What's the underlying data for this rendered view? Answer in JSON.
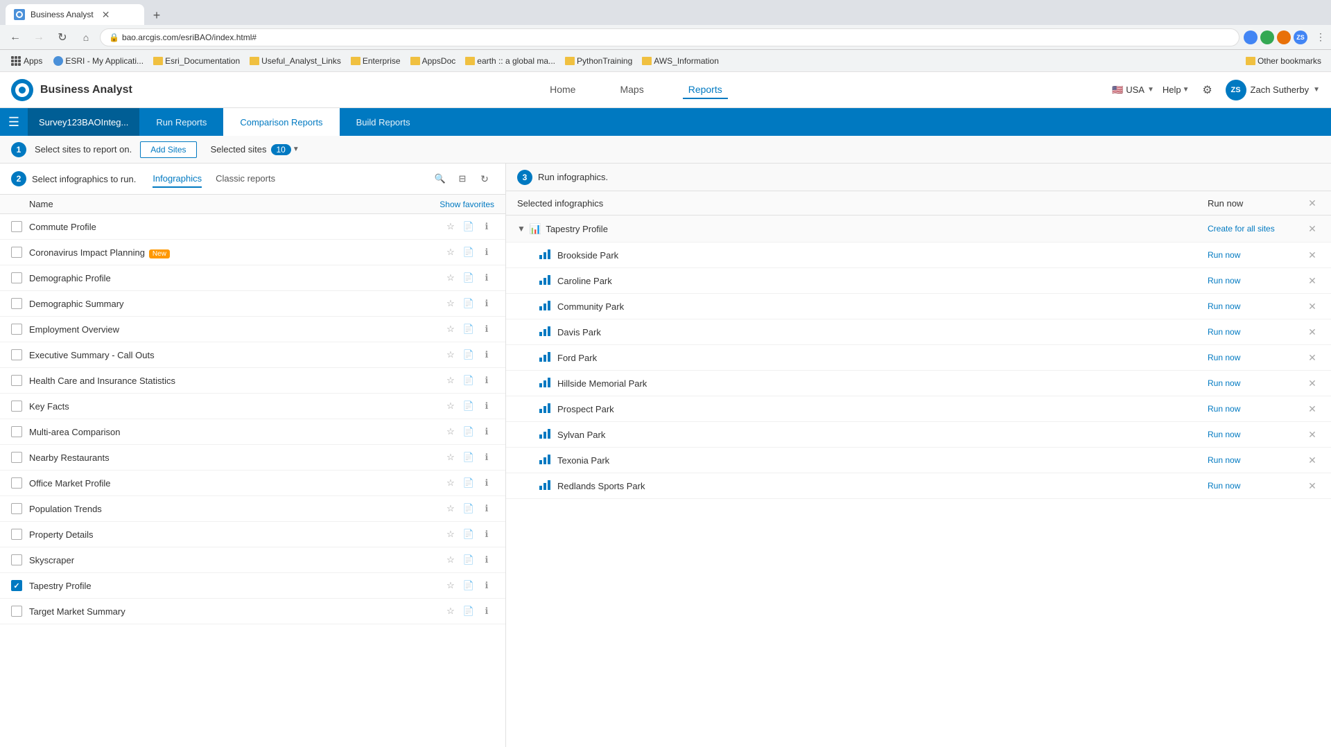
{
  "browser": {
    "tab_title": "Business Analyst",
    "url": "bao.arcgis.com/esriBAO/index.html#",
    "new_tab_label": "+"
  },
  "bookmarks": {
    "apps_label": "Apps",
    "items": [
      {
        "label": "ESRI - My Applicati...",
        "type": "site"
      },
      {
        "label": "Esri_Documentation",
        "type": "folder"
      },
      {
        "label": "Useful_Analyst_Links",
        "type": "folder"
      },
      {
        "label": "Enterprise",
        "type": "folder"
      },
      {
        "label": "AppsDoc",
        "type": "folder"
      },
      {
        "label": "earth :: a global ma...",
        "type": "folder"
      },
      {
        "label": "PythonTraining",
        "type": "folder"
      },
      {
        "label": "AWS_Information",
        "type": "folder"
      },
      {
        "label": "Other bookmarks",
        "type": "folder"
      }
    ]
  },
  "header": {
    "app_title": "Business Analyst",
    "nav_items": [
      "Home",
      "Maps",
      "Reports"
    ],
    "active_nav": "Reports",
    "region": "USA",
    "help_label": "Help",
    "user_name": "Zach Sutherby",
    "user_initials": "ZS"
  },
  "sub_nav": {
    "menu_icon": "☰",
    "active_title": "Survey123BAOInteg...",
    "tabs": [
      {
        "label": "Run Reports",
        "active": false
      },
      {
        "label": "Comparison Reports",
        "active": true
      },
      {
        "label": "Build Reports",
        "active": false
      }
    ]
  },
  "steps": {
    "step1": {
      "number": "1",
      "label": "Select sites to report on.",
      "add_sites_label": "Add Sites",
      "selected_label": "Selected sites",
      "count": "10"
    },
    "step2": {
      "number": "2",
      "label": "Select infographics to run.",
      "tabs": [
        {
          "label": "Infographics",
          "active": true
        },
        {
          "label": "Classic reports",
          "active": false
        }
      ],
      "list_header": "Name",
      "show_favorites": "Show favorites"
    },
    "step3": {
      "number": "3",
      "label": "Run infographics."
    }
  },
  "infographics_list": {
    "items": [
      {
        "name": "Commute Profile",
        "checked": false,
        "new": false
      },
      {
        "name": "Coronavirus Impact Planning",
        "checked": false,
        "new": true
      },
      {
        "name": "Demographic Profile",
        "checked": false,
        "new": false
      },
      {
        "name": "Demographic Summary",
        "checked": false,
        "new": false
      },
      {
        "name": "Employment Overview",
        "checked": false,
        "new": false
      },
      {
        "name": "Executive Summary - Call Outs",
        "checked": false,
        "new": false
      },
      {
        "name": "Health Care and Insurance Statistics",
        "checked": false,
        "new": false
      },
      {
        "name": "Key Facts",
        "checked": false,
        "new": false
      },
      {
        "name": "Multi-area Comparison",
        "checked": false,
        "new": false
      },
      {
        "name": "Nearby Restaurants",
        "checked": false,
        "new": false
      },
      {
        "name": "Office Market Profile",
        "checked": false,
        "new": false
      },
      {
        "name": "Population Trends",
        "checked": false,
        "new": false
      },
      {
        "name": "Property Details",
        "checked": false,
        "new": false
      },
      {
        "name": "Skyscraper",
        "checked": false,
        "new": false
      },
      {
        "name": "Tapestry Profile",
        "checked": true,
        "new": false
      },
      {
        "name": "Target Market Summary",
        "checked": false,
        "new": false
      }
    ]
  },
  "selected_infographics": {
    "header_title": "Selected infographics",
    "run_now_header": "Run now",
    "groups": [
      {
        "name": "Tapestry Profile",
        "create_all_label": "Create for all sites",
        "sites": [
          {
            "name": "Brookside Park",
            "run_now": "Run now"
          },
          {
            "name": "Caroline Park",
            "run_now": "Run now"
          },
          {
            "name": "Community Park",
            "run_now": "Run now"
          },
          {
            "name": "Davis Park",
            "run_now": "Run now"
          },
          {
            "name": "Ford Park",
            "run_now": "Run now"
          },
          {
            "name": "Hillside Memorial Park",
            "run_now": "Run now"
          },
          {
            "name": "Prospect Park",
            "run_now": "Run now"
          },
          {
            "name": "Sylvan Park",
            "run_now": "Run now"
          },
          {
            "name": "Texonia Park",
            "run_now": "Run now"
          },
          {
            "name": "Redlands Sports Park",
            "run_now": "Run now"
          }
        ]
      }
    ]
  },
  "new_badge_label": "New",
  "search_icon": "🔍",
  "filter_icon": "⊟",
  "refresh_icon": "↻",
  "star_icon": "☆",
  "doc_icon": "📄",
  "info_icon": "ℹ",
  "close_icon": "✕",
  "chart_icon": "📊",
  "chevron_down": "▼",
  "chevron_right": "▶",
  "checkmark": "✓"
}
